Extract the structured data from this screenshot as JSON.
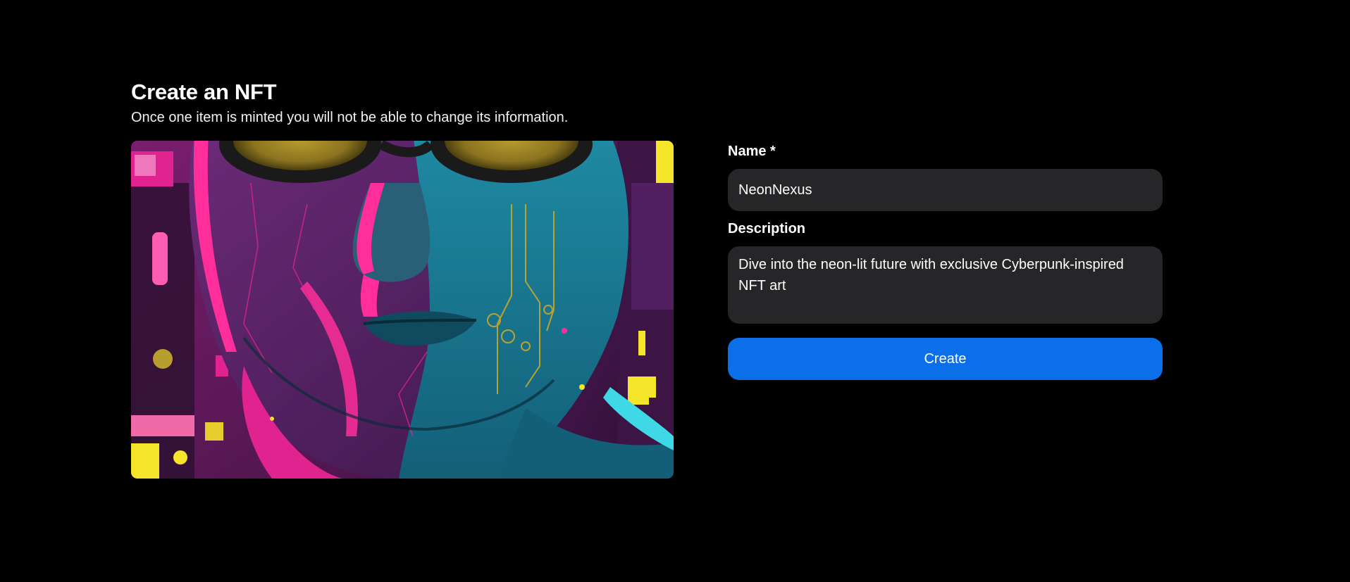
{
  "header": {
    "title": "Create an NFT",
    "subtitle": "Once one item is minted you will not be able to change its information."
  },
  "artwork": {
    "alt": "Cyberpunk neon portrait with bitcoin goggles",
    "palette": {
      "magenta": "#e0238f",
      "teal": "#1d7d96",
      "dark_teal": "#0f4a5e",
      "purple": "#5a1f5e",
      "gold": "#c9a92c",
      "cyan": "#3fd8e6",
      "yellow": "#f5e52a"
    }
  },
  "form": {
    "name_label": "Name *",
    "name_value": "NeonNexus",
    "description_label": "Description",
    "description_value": "Dive into the neon-lit future with exclusive Cyberpunk-inspired NFT art",
    "create_label": "Create"
  },
  "colors": {
    "background": "#000000",
    "field_background": "#262628",
    "primary_button": "#0a6fe8",
    "text": "#ffffff"
  }
}
